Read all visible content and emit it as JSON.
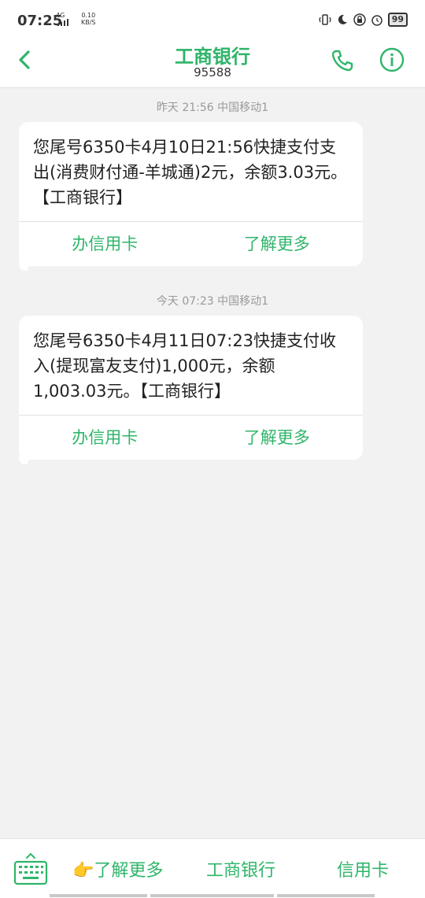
{
  "status": {
    "time": "07:25",
    "net_top": "4G",
    "speed_value": "0.10",
    "speed_unit": "KB/S",
    "battery": "99"
  },
  "header": {
    "title": "工商银行",
    "number": "95588"
  },
  "messages": [
    {
      "meta": "昨天 21:56  中国移动1",
      "text": "您尾号6350卡4月10日21:56快捷支付支出(消费财付通-羊城通)2元，余额3.03元。【工商银行】",
      "actions": [
        "办信用卡",
        "了解更多"
      ]
    },
    {
      "meta": "今天 07:23  中国移动1",
      "text": "您尾号6350卡4月11日07:23快捷支付收入(提现富友支付)1,000元，余额1,003.03元。【工商银行】",
      "actions": [
        "办信用卡",
        "了解更多"
      ]
    }
  ],
  "bottom": {
    "menu1": "👉了解更多",
    "menu2": "工商银行",
    "menu3": "信用卡"
  },
  "colors": {
    "accent": "#2fb56a",
    "background": "#f2f2f2"
  }
}
